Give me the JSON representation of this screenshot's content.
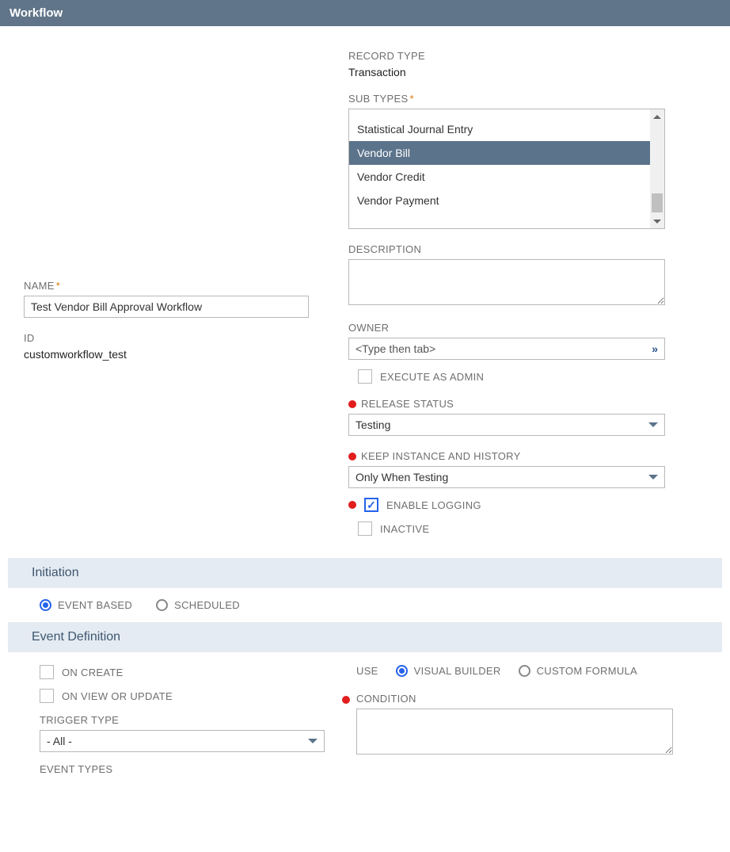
{
  "header": {
    "title": "Workflow"
  },
  "left": {
    "name_label": "NAME",
    "name_value": "Test Vendor Bill Approval Workflow",
    "id_label": "ID",
    "id_value": "customworkflow_test"
  },
  "right": {
    "record_type_label": "RECORD TYPE",
    "record_type_value": "Transaction",
    "sub_types_label": "SUB TYPES",
    "sub_types": {
      "items": [
        {
          "label": ""
        },
        {
          "label": "Statistical Journal Entry"
        },
        {
          "label": "Vendor Bill"
        },
        {
          "label": "Vendor Credit"
        },
        {
          "label": "Vendor Payment"
        }
      ],
      "selected_index": 2
    },
    "description_label": "DESCRIPTION",
    "description_value": "",
    "owner_label": "OWNER",
    "owner_placeholder": "<Type then tab>",
    "execute_admin_label": "EXECUTE AS ADMIN",
    "release_status_label": "RELEASE STATUS",
    "release_status_value": "Testing",
    "keep_instance_label": "KEEP INSTANCE AND HISTORY",
    "keep_instance_value": "Only When Testing",
    "enable_logging_label": "ENABLE LOGGING",
    "inactive_label": "INACTIVE"
  },
  "initiation": {
    "header": "Initiation",
    "event_based_label": "EVENT BASED",
    "scheduled_label": "SCHEDULED"
  },
  "event_def": {
    "header": "Event Definition",
    "on_create_label": "ON CREATE",
    "on_view_update_label": "ON VIEW OR UPDATE",
    "trigger_type_label": "TRIGGER TYPE",
    "trigger_type_value": "- All -",
    "event_types_label": "EVENT TYPES",
    "use_label": "USE",
    "visual_builder_label": "VISUAL BUILDER",
    "custom_formula_label": "CUSTOM FORMULA",
    "condition_label": "CONDITION",
    "condition_value": ""
  }
}
